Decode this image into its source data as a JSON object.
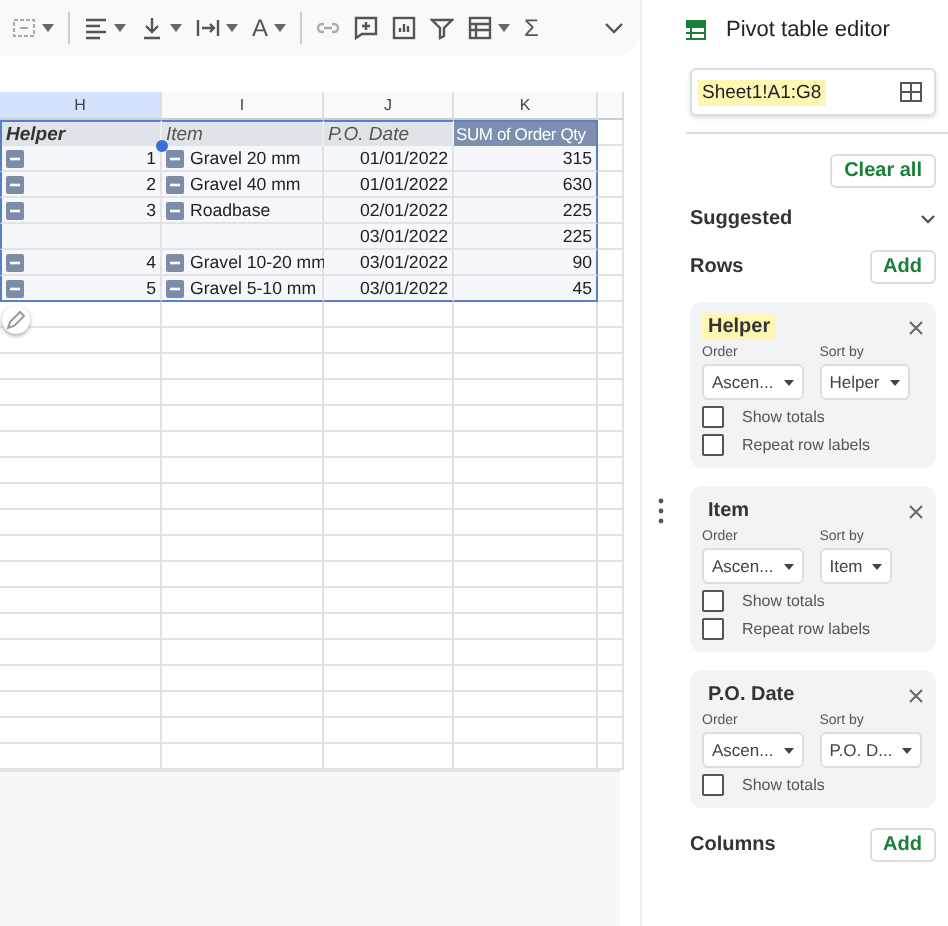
{
  "toolbar": [
    {
      "kind": "icon",
      "dropdown": true
    },
    {
      "kind": "divider"
    },
    {
      "kind": "icon",
      "dropdown": true
    },
    {
      "kind": "icon",
      "dropdown": true
    },
    {
      "kind": "icon",
      "dropdown": true
    },
    {
      "kind": "glyph",
      "text": "A",
      "dropdown": true
    },
    {
      "kind": "divider"
    },
    {
      "kind": "icon",
      "dropdown": false
    },
    {
      "kind": "icon",
      "dropdown": false
    },
    {
      "kind": "icon",
      "dropdown": false
    },
    {
      "kind": "icon",
      "dropdown": false
    },
    {
      "kind": "icon",
      "dropdown": true
    },
    {
      "kind": "glyph",
      "text": "Σ",
      "dropdown": false
    },
    {
      "kind": "chevron"
    }
  ],
  "sheet": {
    "columns": [
      "H",
      "I",
      "J",
      "K"
    ],
    "header": [
      "Helper",
      "Item",
      "P.O. Date",
      "SUM of Order Qty"
    ],
    "rows": [
      {
        "helper": "1",
        "helper_toggle": true,
        "item": "Gravel 20 mm",
        "item_toggle": true,
        "date": "01/01/2022",
        "qty": "315"
      },
      {
        "helper": "2",
        "helper_toggle": true,
        "item": "Gravel 40 mm",
        "item_toggle": true,
        "date": "01/01/2022",
        "qty": "630"
      },
      {
        "helper": "3",
        "helper_toggle": true,
        "item": "Roadbase",
        "item_toggle": true,
        "date": "02/01/2022",
        "qty": "225"
      },
      {
        "helper": "",
        "helper_toggle": false,
        "item": "",
        "item_toggle": false,
        "date": "03/01/2022",
        "qty": "225"
      },
      {
        "helper": "4",
        "helper_toggle": true,
        "item": "Gravel 10-20 mm",
        "item_toggle": true,
        "date": "03/01/2022",
        "qty": "90"
      },
      {
        "helper": "5",
        "helper_toggle": true,
        "item": "Gravel 5-10 mm",
        "item_toggle": true,
        "date": "03/01/2022",
        "qty": "45"
      }
    ]
  },
  "editor": {
    "title": "Pivot table editor",
    "range": {
      "value": "Sheet1!A1:G8",
      "highlighted": true
    },
    "clear_button": "Clear all",
    "suggested": "Suggested",
    "rows_section": {
      "label": "Rows",
      "add_button": "Add"
    },
    "cards": [
      {
        "title": "Helper",
        "highlighted": true,
        "order_label": "Order",
        "order": "Ascen...",
        "sort_label": "Sort by",
        "sort": "Helper",
        "options": [
          {
            "label": "Show totals",
            "checked": false
          },
          {
            "label": "Repeat row labels",
            "checked": false
          }
        ]
      },
      {
        "title": "Item",
        "highlighted": false,
        "order_label": "Order",
        "order": "Ascen...",
        "sort_label": "Sort by",
        "sort": "Item",
        "options": [
          {
            "label": "Show totals",
            "checked": false
          },
          {
            "label": "Repeat row labels",
            "checked": false
          }
        ]
      },
      {
        "title": "P.O. Date",
        "highlighted": false,
        "order_label": "Order",
        "order": "Ascen...",
        "sort_label": "Sort by",
        "sort": "P.O. D...",
        "options": [
          {
            "label": "Show totals",
            "checked": false
          }
        ]
      }
    ],
    "columns_section": {
      "label": "Columns",
      "add_button": "Add"
    }
  }
}
